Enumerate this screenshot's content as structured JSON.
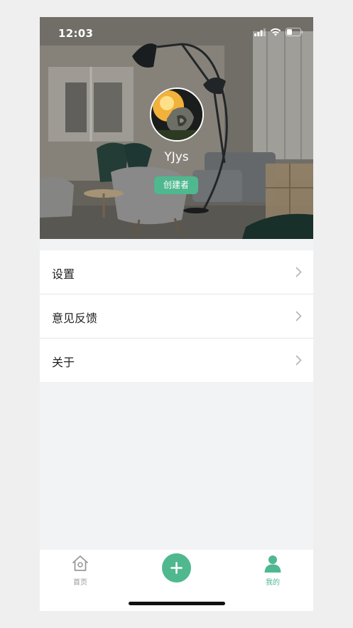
{
  "status_bar": {
    "time": "12:03"
  },
  "profile": {
    "username": "YJys",
    "role_badge": "创建者"
  },
  "menu": {
    "items": [
      {
        "label": "设置",
        "icon": "chevron-right-icon"
      },
      {
        "label": "意见反馈",
        "icon": "chevron-right-icon"
      },
      {
        "label": "关于",
        "icon": "chevron-right-icon"
      }
    ]
  },
  "tabbar": {
    "home_label": "首页",
    "add_icon": "plus-icon",
    "mine_label": "我的",
    "active_tab": "mine"
  },
  "colors": {
    "accent": "#4fb88f",
    "background": "#f2f3f5",
    "inactive": "#999999"
  }
}
